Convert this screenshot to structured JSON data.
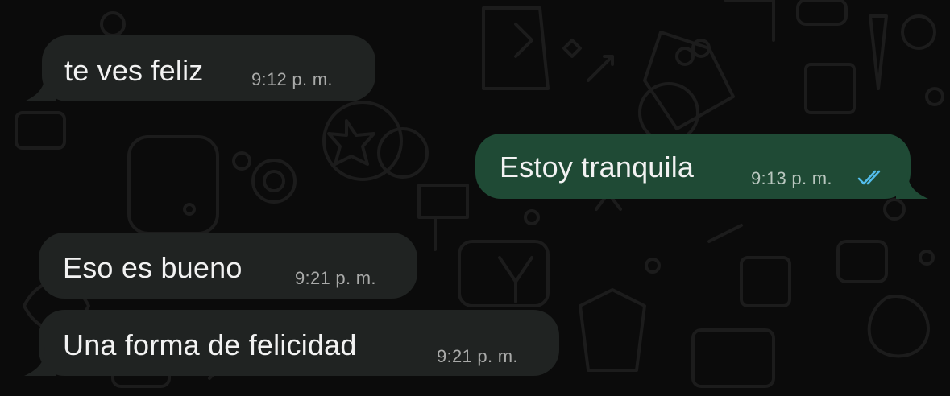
{
  "messages": [
    {
      "direction": "incoming",
      "text": "te ves feliz",
      "time": "9:12 p. m."
    },
    {
      "direction": "outgoing",
      "text": "Estoy tranquila",
      "time": "9:13 p. m.",
      "status": "read"
    },
    {
      "direction": "incoming",
      "text": "Eso es bueno",
      "time": "9:21 p. m."
    },
    {
      "direction": "incoming",
      "text": "Una forma de felicidad",
      "time": "9:21 p. m."
    }
  ],
  "colors": {
    "background": "#0b0b0b",
    "incoming_bubble": "#202322",
    "outgoing_bubble": "#1f4a35",
    "read_receipt": "#53bdeb"
  },
  "icons": {
    "read_receipt": "double-check-icon"
  }
}
